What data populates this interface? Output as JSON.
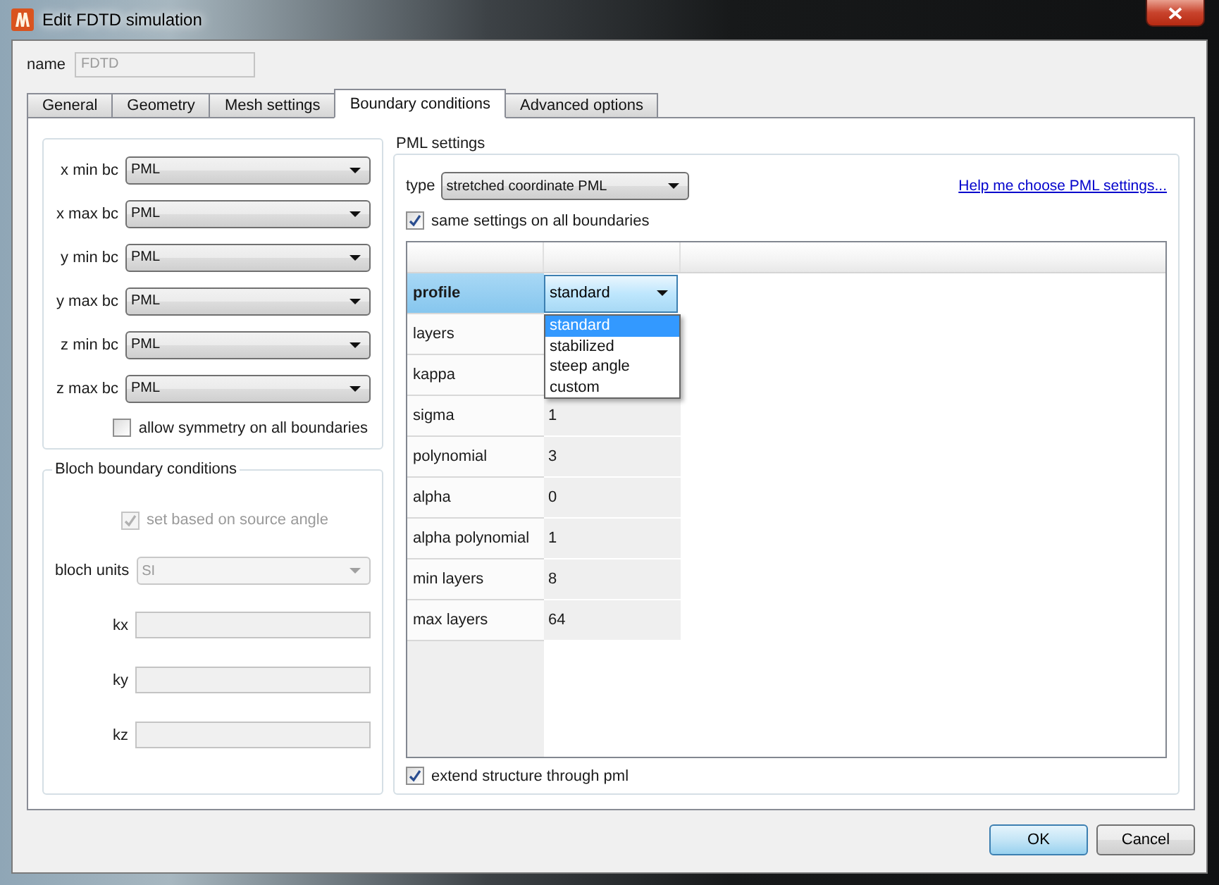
{
  "window": {
    "title": "Edit FDTD simulation"
  },
  "name_field": {
    "label": "name",
    "value": "FDTD",
    "disabled": true
  },
  "tabs": [
    {
      "label": "General",
      "selected": false
    },
    {
      "label": "Geometry",
      "selected": false
    },
    {
      "label": "Mesh settings",
      "selected": false
    },
    {
      "label": "Boundary conditions",
      "selected": true
    },
    {
      "label": "Advanced options",
      "selected": false
    }
  ],
  "boundaries": {
    "rows": [
      {
        "label": "x min bc",
        "value": "PML"
      },
      {
        "label": "x max bc",
        "value": "PML"
      },
      {
        "label": "y min bc",
        "value": "PML"
      },
      {
        "label": "y max bc",
        "value": "PML"
      },
      {
        "label": "z min bc",
        "value": "PML"
      },
      {
        "label": "z max bc",
        "value": "PML"
      }
    ],
    "symmetry": {
      "label": "allow symmetry on all boundaries",
      "checked": false
    }
  },
  "bloch": {
    "title": "Bloch boundary conditions",
    "source_angle": {
      "label": "set based on source angle",
      "checked": true,
      "disabled": true
    },
    "units": {
      "label": "bloch units",
      "value": "SI",
      "disabled": true
    },
    "k_fields": [
      {
        "label": "kx",
        "disabled": true
      },
      {
        "label": "ky",
        "disabled": true
      },
      {
        "label": "kz",
        "disabled": true
      }
    ]
  },
  "pml": {
    "title": "PML settings",
    "type": {
      "label": "type",
      "value": "stretched coordinate PML"
    },
    "help_link": "Help me choose PML settings...",
    "same_settings": {
      "label": "same settings on all boundaries",
      "checked": true
    },
    "table": {
      "rows": [
        {
          "name": "profile",
          "value": "standard",
          "selected": true
        },
        {
          "name": "layers",
          "selected": false
        },
        {
          "name": "kappa",
          "selected": false
        },
        {
          "name": "sigma",
          "value": "1",
          "selected": false
        },
        {
          "name": "polynomial",
          "value": "3",
          "selected": false
        },
        {
          "name": "alpha",
          "value": "0",
          "selected": false
        },
        {
          "name": "alpha polynomial",
          "value": "1",
          "selected": false
        },
        {
          "name": "min layers",
          "value": "8",
          "selected": false
        },
        {
          "name": "max layers",
          "value": "64",
          "selected": false
        }
      ]
    },
    "profile_menu": {
      "options": [
        {
          "label": "standard",
          "selected": true
        },
        {
          "label": "stabilized",
          "selected": false
        },
        {
          "label": "steep angle",
          "selected": false
        },
        {
          "label": "custom",
          "selected": false
        }
      ]
    },
    "extend": {
      "label": "extend structure through pml",
      "checked": true
    }
  },
  "buttons": [
    {
      "label": "OK",
      "default": true
    },
    {
      "label": "Cancel",
      "default": false
    }
  ]
}
